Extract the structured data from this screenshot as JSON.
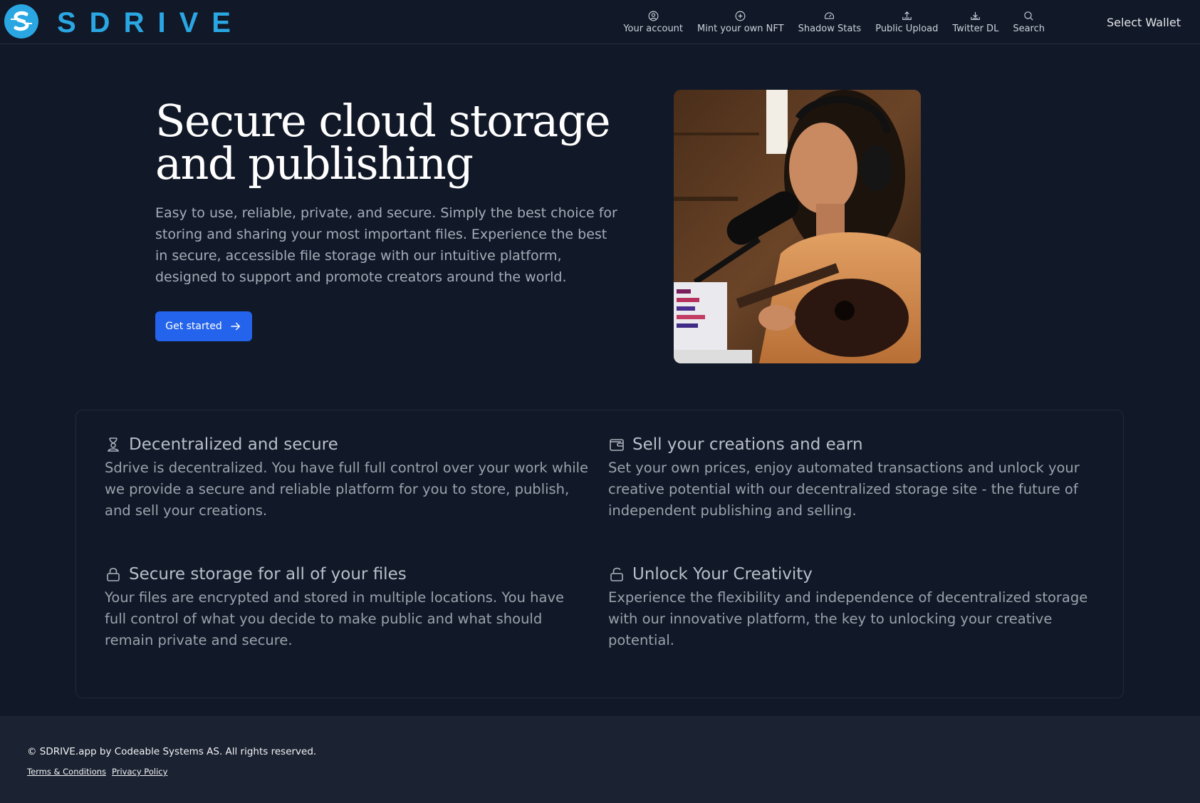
{
  "header": {
    "brand_name": "SDRIVE",
    "brand_color": "#2aa7e3",
    "nav": [
      {
        "label": "Your account",
        "icon": "user-circle-icon"
      },
      {
        "label": "Mint your own NFT",
        "icon": "plus-circle-icon"
      },
      {
        "label": "Shadow Stats",
        "icon": "gauge-icon"
      },
      {
        "label": "Public Upload",
        "icon": "upload-icon"
      },
      {
        "label": "Twitter DL",
        "icon": "download-icon"
      },
      {
        "label": "Search",
        "icon": "search-icon"
      }
    ],
    "wallet_label": "Select Wallet"
  },
  "hero": {
    "title": "Secure cloud storage and publishing",
    "description": "Easy to use, reliable, private, and secure. Simply the best choice for storing and sharing your most important files. Experience the best in secure, accessible file storage with our intuitive platform, designed to support and promote creators around the world.",
    "cta_label": "Get started",
    "cta_color": "#2463eb"
  },
  "features": [
    {
      "icon": "hourglass-user-icon",
      "title": "Decentralized and secure",
      "text": "Sdrive is decentralized. You have full full control over your work while we provide a secure and reliable platform for you to store, publish, and sell your creations."
    },
    {
      "icon": "wallet-icon",
      "title": "Sell your creations and earn",
      "text": "Set your own prices, enjoy automated transactions and unlock your creative potential with our decentralized storage site - the future of independent publishing and selling."
    },
    {
      "icon": "lock-icon",
      "title": "Secure storage for all of your files",
      "text": "Your files are encrypted and stored in multiple locations. You have full control of what you decide to make public and what should remain private and secure."
    },
    {
      "icon": "unlock-icon",
      "title": "Unlock Your Creativity",
      "text": "Experience the flexibility and independence of decentralized storage with our innovative platform, the key to unlocking your creative potential."
    }
  ],
  "footer": {
    "copyright": "© SDRIVE.app by Codeable Systems AS. All rights reserved.",
    "links": [
      "Terms & Conditions",
      "Privacy Policy"
    ]
  }
}
